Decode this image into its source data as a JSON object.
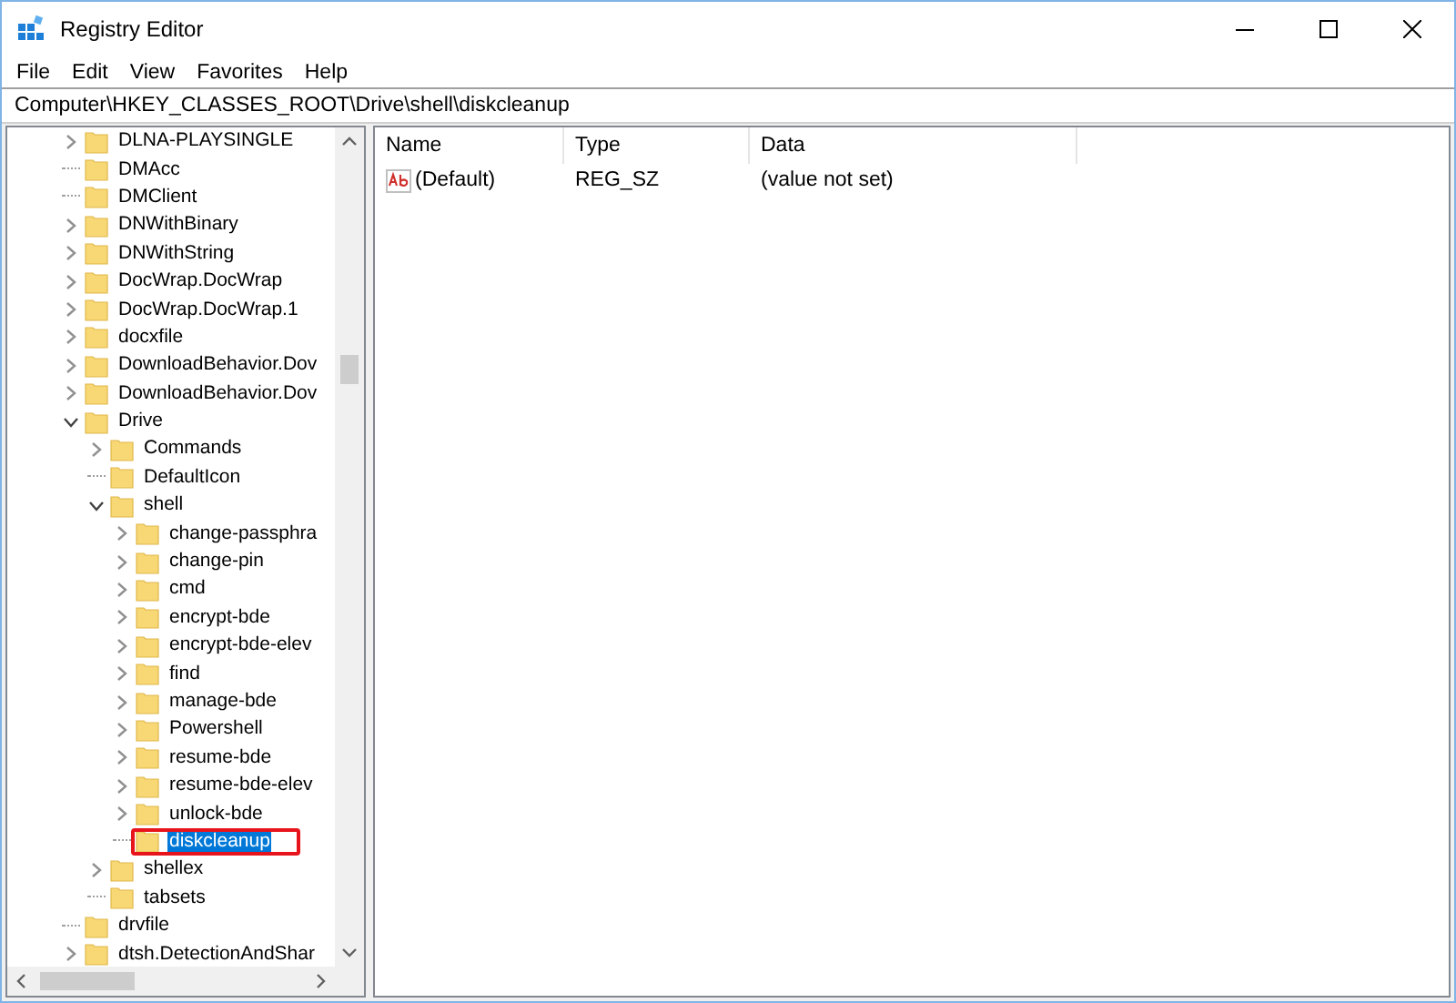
{
  "window": {
    "title": "Registry Editor"
  },
  "menu": [
    "File",
    "Edit",
    "View",
    "Favorites",
    "Help"
  ],
  "address": "Computer\\HKEY_CLASSES_ROOT\\Drive\\shell\\diskcleanup",
  "tree": {
    "highlight_selected": true,
    "nodes": [
      {
        "label": "DLNA-PLAYSINGLE",
        "expandable": true,
        "expanded": false,
        "selected": false
      },
      {
        "label": "DMAcc",
        "expandable": false,
        "selected": false
      },
      {
        "label": "DMClient",
        "expandable": false,
        "selected": false
      },
      {
        "label": "DNWithBinary",
        "expandable": true,
        "expanded": false,
        "selected": false
      },
      {
        "label": "DNWithString",
        "expandable": true,
        "expanded": false,
        "selected": false
      },
      {
        "label": "DocWrap.DocWrap",
        "expandable": true,
        "expanded": false,
        "selected": false
      },
      {
        "label": "DocWrap.DocWrap.1",
        "expandable": true,
        "expanded": false,
        "selected": false
      },
      {
        "label": "docxfile",
        "expandable": true,
        "expanded": false,
        "selected": false
      },
      {
        "label": "DownloadBehavior.Dov",
        "expandable": true,
        "expanded": false,
        "selected": false
      },
      {
        "label": "DownloadBehavior.Dov",
        "expandable": true,
        "expanded": false,
        "selected": false
      },
      {
        "label": "Drive",
        "expandable": true,
        "expanded": true,
        "selected": false,
        "children": [
          {
            "label": "Commands",
            "expandable": true,
            "expanded": false,
            "selected": false
          },
          {
            "label": "DefaultIcon",
            "expandable": false,
            "selected": false
          },
          {
            "label": "shell",
            "expandable": true,
            "expanded": true,
            "selected": false,
            "children": [
              {
                "label": "change-passphra",
                "expandable": true,
                "expanded": false,
                "selected": false
              },
              {
                "label": "change-pin",
                "expandable": true,
                "expanded": false,
                "selected": false
              },
              {
                "label": "cmd",
                "expandable": true,
                "expanded": false,
                "selected": false
              },
              {
                "label": "encrypt-bde",
                "expandable": true,
                "expanded": false,
                "selected": false
              },
              {
                "label": "encrypt-bde-elev",
                "expandable": true,
                "expanded": false,
                "selected": false
              },
              {
                "label": "find",
                "expandable": true,
                "expanded": false,
                "selected": false
              },
              {
                "label": "manage-bde",
                "expandable": true,
                "expanded": false,
                "selected": false
              },
              {
                "label": "Powershell",
                "expandable": true,
                "expanded": false,
                "selected": false
              },
              {
                "label": "resume-bde",
                "expandable": true,
                "expanded": false,
                "selected": false
              },
              {
                "label": "resume-bde-elev",
                "expandable": true,
                "expanded": false,
                "selected": false
              },
              {
                "label": "unlock-bde",
                "expandable": true,
                "expanded": false,
                "selected": false
              },
              {
                "label": "diskcleanup",
                "expandable": false,
                "selected": true
              }
            ]
          },
          {
            "label": "shellex",
            "expandable": true,
            "expanded": false,
            "selected": false
          },
          {
            "label": "tabsets",
            "expandable": false,
            "selected": false
          }
        ]
      },
      {
        "label": "drvfile",
        "expandable": false,
        "selected": false
      },
      {
        "label": "dtsh.DetectionAndShar",
        "expandable": true,
        "expanded": false,
        "selected": false
      }
    ]
  },
  "values": {
    "columns": [
      "Name",
      "Type",
      "Data"
    ],
    "rows": [
      {
        "name": "(Default)",
        "type": "REG_SZ",
        "data": "(value not set)"
      }
    ]
  }
}
